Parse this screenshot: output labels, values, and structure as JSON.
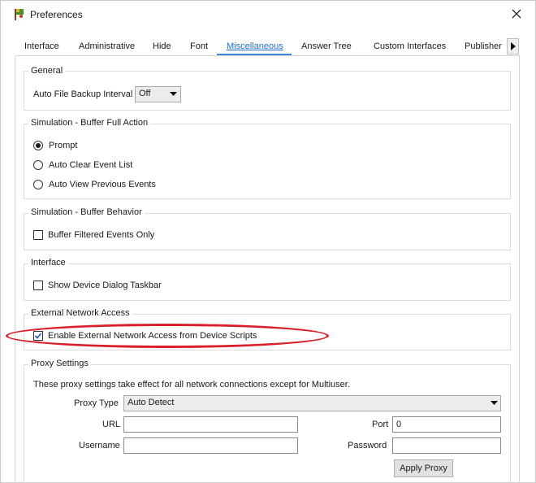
{
  "window": {
    "title": "Preferences"
  },
  "tabs": [
    {
      "label": "Interface"
    },
    {
      "label": "Administrative"
    },
    {
      "label": "Hide"
    },
    {
      "label": "Font"
    },
    {
      "label": "Miscellaneous"
    },
    {
      "label": "Answer Tree"
    },
    {
      "label": "Custom Interfaces"
    },
    {
      "label": "Publisher"
    }
  ],
  "active_tab": "Miscellaneous",
  "general": {
    "title": "General",
    "backup_label": "Auto File Backup Interval",
    "backup_value": "Off"
  },
  "buffer_full": {
    "title": "Simulation - Buffer Full Action",
    "options": [
      {
        "label": "Prompt",
        "selected": true
      },
      {
        "label": "Auto Clear Event List",
        "selected": false
      },
      {
        "label": "Auto View Previous Events",
        "selected": false
      }
    ]
  },
  "buffer_behavior": {
    "title": "Simulation - Buffer Behavior",
    "checkbox_label": "Buffer Filtered Events Only",
    "checked": false
  },
  "interface_group": {
    "title": "Interface",
    "checkbox_label": "Show Device Dialog Taskbar",
    "checked": false
  },
  "external_network": {
    "title": "External Network Access",
    "checkbox_label": "Enable External Network Access from Device Scripts",
    "checked": true
  },
  "proxy": {
    "title": "Proxy Settings",
    "note": "These proxy settings take effect for all network connections except for Multiuser.",
    "type_label": "Proxy Type",
    "type_value": "Auto Detect",
    "url_label": "URL",
    "url_value": "",
    "port_label": "Port",
    "port_value": "0",
    "username_label": "Username",
    "username_value": "",
    "password_label": "Password",
    "password_value": "",
    "apply_label": "Apply Proxy"
  },
  "colors": {
    "accent": "#3b86d6",
    "highlight_ellipse": "#d9202a"
  }
}
